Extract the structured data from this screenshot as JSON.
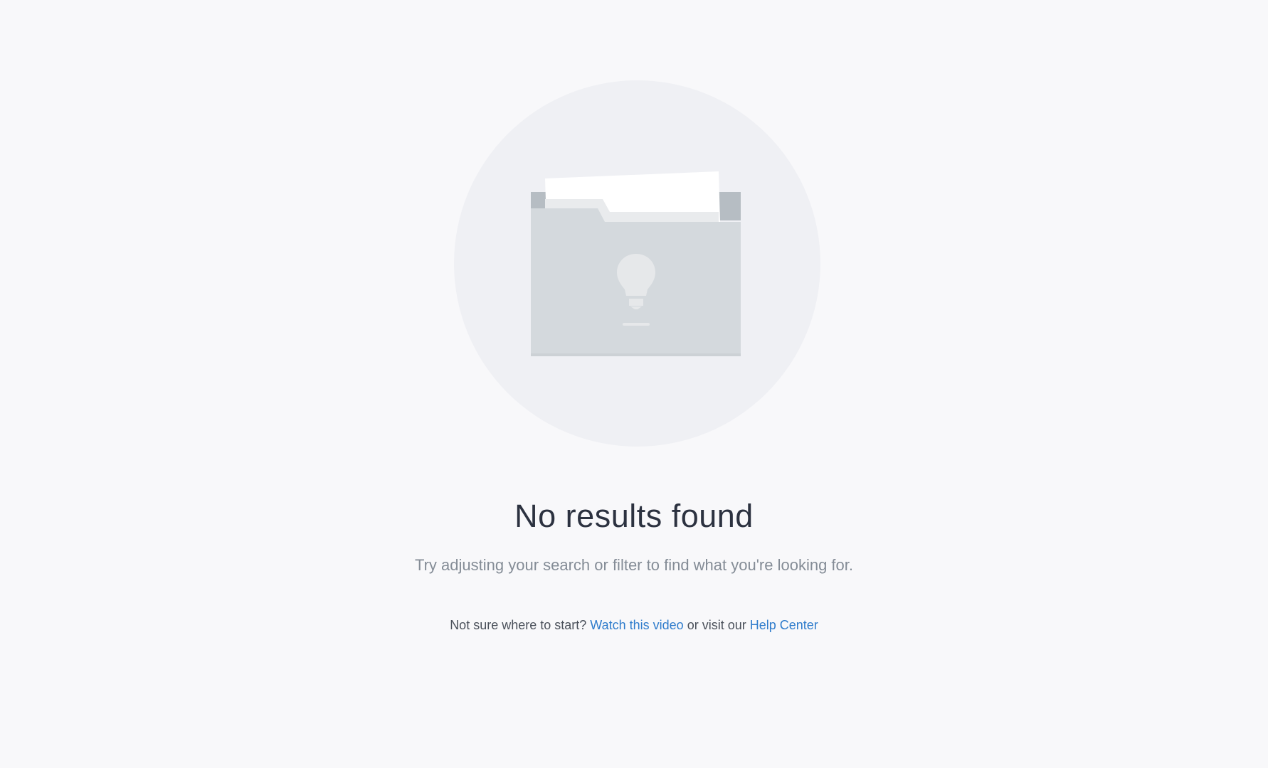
{
  "illustration": {
    "icon": "folder-lightbulb-icon",
    "colors": {
      "circle": "#eff0f4",
      "folder": "#d4d9dd",
      "folder_tab": "#b6bdc3",
      "paper": "#ffffff"
    }
  },
  "empty_state": {
    "title": "No results found",
    "subtitle": "Try adjusting your search or filter to find what you're looking for."
  },
  "help": {
    "prefix": "Not sure where to start?",
    "video_link": "Watch this video",
    "middle": "or visit our",
    "help_center_link": "Help Center",
    "link_color": "#2f7ccc"
  }
}
